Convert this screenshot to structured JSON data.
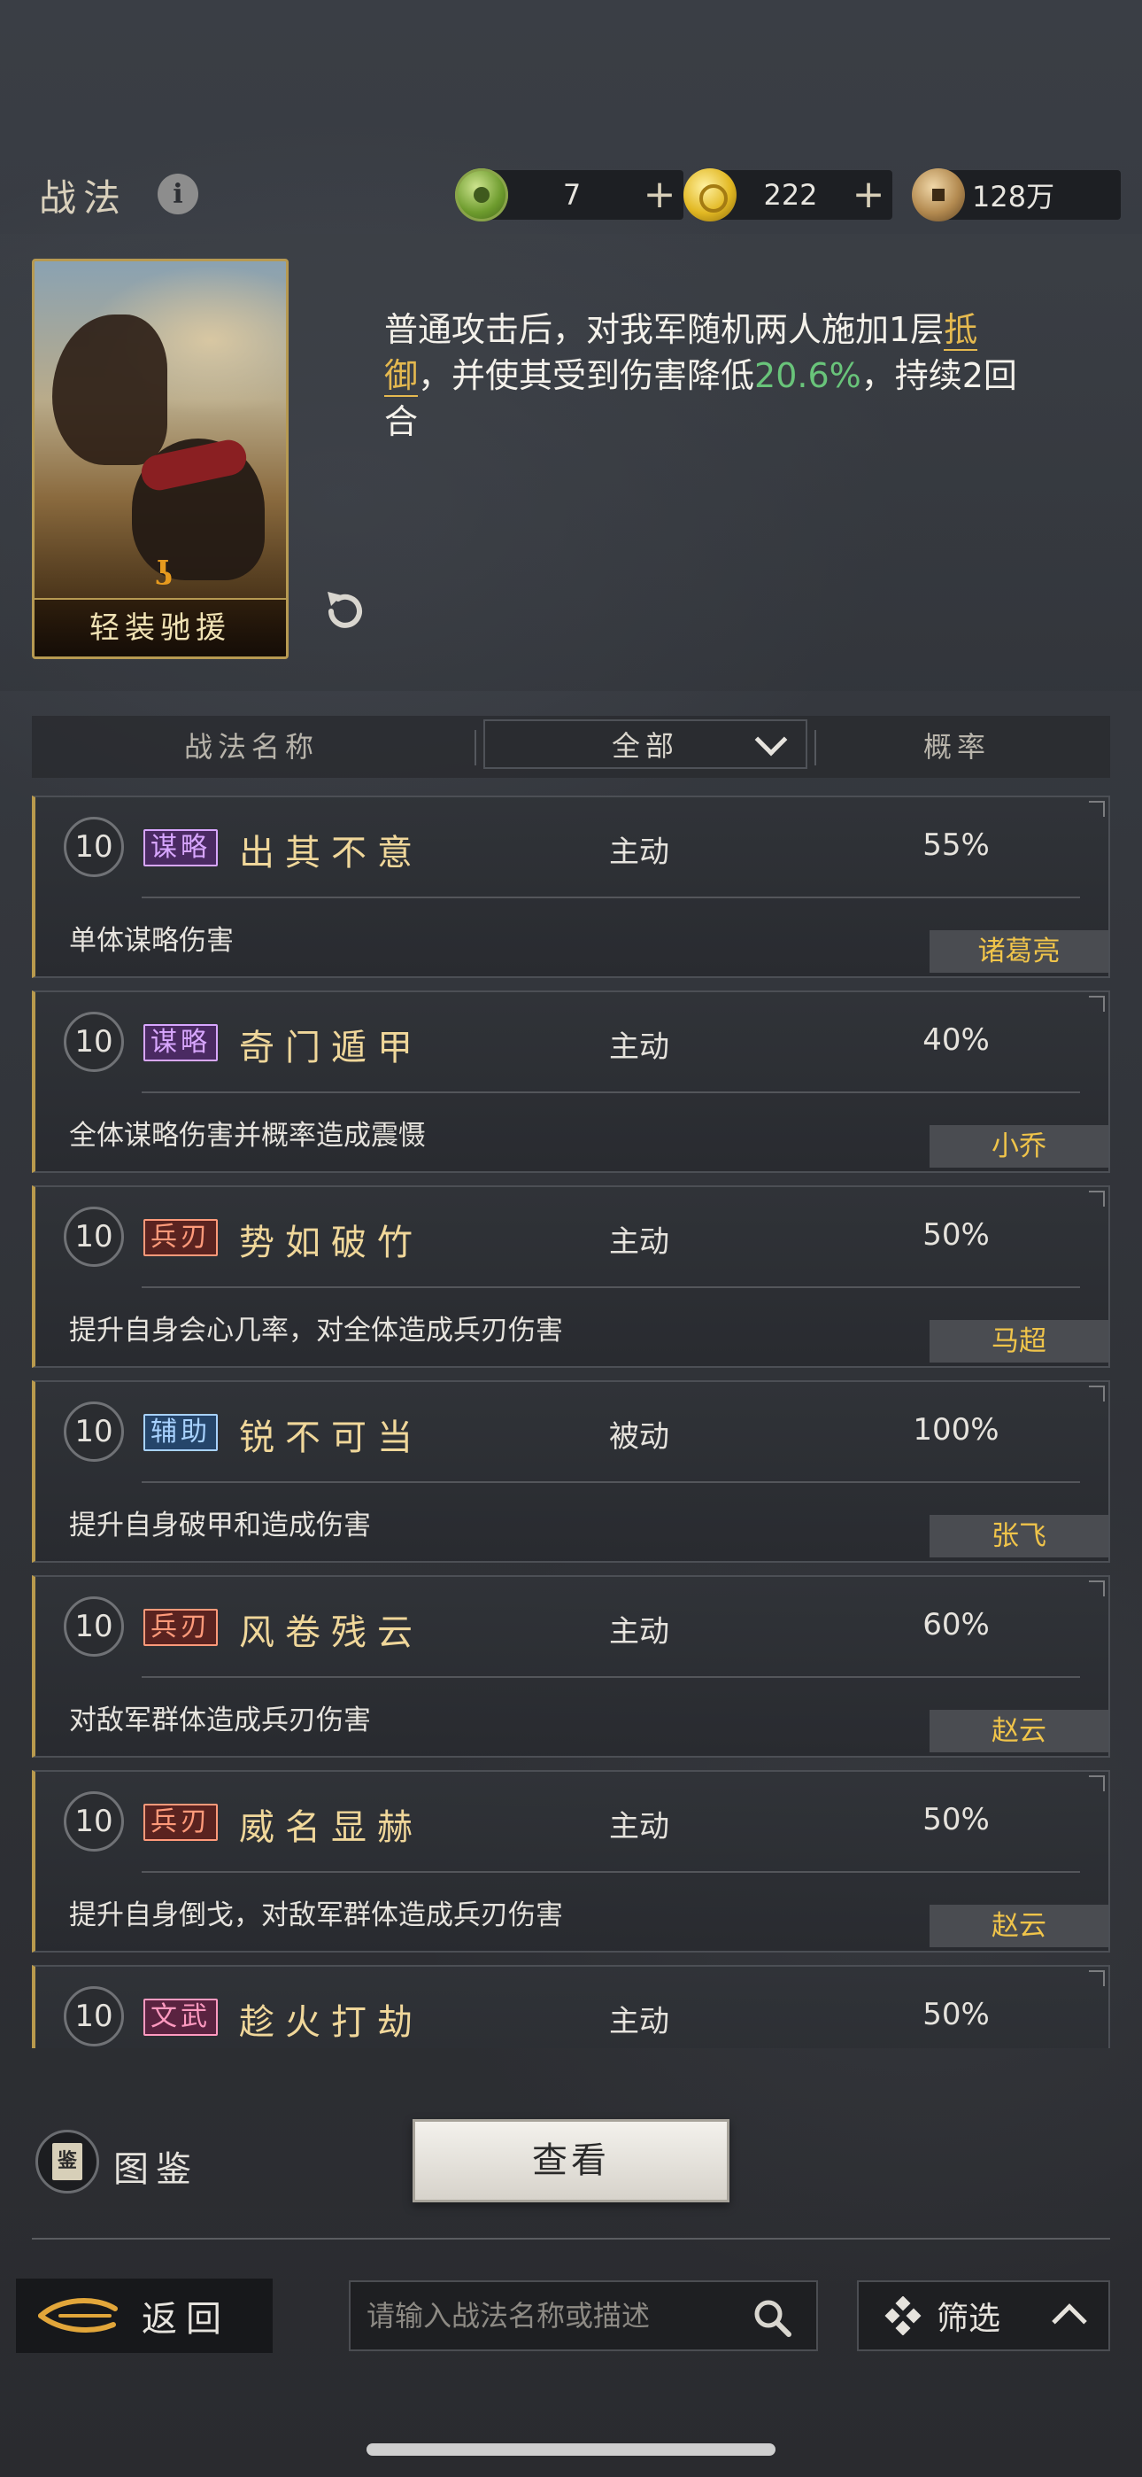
{
  "header": {
    "title": "战法",
    "info_icon": "info-icon",
    "resources": [
      {
        "icon": "jade-coin-icon",
        "value": "7",
        "has_plus": true
      },
      {
        "icon": "gold-coin-icon",
        "value": "222",
        "has_plus": true
      },
      {
        "icon": "copper-coin-icon",
        "value": "128万",
        "has_plus": false
      }
    ],
    "plus_label": "+"
  },
  "selected_tactic": {
    "card_name": "轻装驰援",
    "description_parts": {
      "p1": "普通攻击后，对我军随机两人施加1层",
      "highlight": "抵御",
      "p2": "，并使其受到伤害降低",
      "number": "20.6%",
      "p3": "，持续2回合"
    },
    "colors": {
      "highlight": "#e5b94f",
      "number": "#69c47a"
    }
  },
  "table_header": {
    "name_col": "战法名称",
    "filter_value": "全部",
    "rate_col": "概率"
  },
  "tactics": [
    {
      "level": "10",
      "tag": "谋略",
      "tag_type": "mou",
      "name": "出其不意",
      "type": "主动",
      "rate": "55%",
      "desc": "单体谋略伤害",
      "hero": "诸葛亮"
    },
    {
      "level": "10",
      "tag": "谋略",
      "tag_type": "mou",
      "name": "奇门遁甲",
      "type": "主动",
      "rate": "40%",
      "desc": "全体谋略伤害并概率造成震慑",
      "hero": "小乔"
    },
    {
      "level": "10",
      "tag": "兵刃",
      "tag_type": "bing",
      "name": "势如破竹",
      "type": "主动",
      "rate": "50%",
      "desc": "提升自身会心几率，对全体造成兵刃伤害",
      "hero": "马超"
    },
    {
      "level": "10",
      "tag": "辅助",
      "tag_type": "fu",
      "name": "锐不可当",
      "type": "被动",
      "rate": "100%",
      "desc": "提升自身破甲和造成伤害",
      "hero": "张飞"
    },
    {
      "level": "10",
      "tag": "兵刃",
      "tag_type": "bing",
      "name": "风卷残云",
      "type": "主动",
      "rate": "60%",
      "desc": "对敌军群体造成兵刃伤害",
      "hero": "赵云"
    },
    {
      "level": "10",
      "tag": "兵刃",
      "tag_type": "bing",
      "name": "威名显赫",
      "type": "主动",
      "rate": "50%",
      "desc": "提升自身倒戈，对敌军群体造成兵刃伤害",
      "hero": "赵云"
    },
    {
      "level": "10",
      "tag": "文武",
      "tag_type": "wen",
      "name": "趁火打劫",
      "type": "主动",
      "rate": "50%",
      "desc": "",
      "hero": ""
    }
  ],
  "bottom": {
    "tujian_icon_text": "鉴",
    "tujian_label": "图鉴",
    "view_button": "查看",
    "back_label": "返回",
    "search_placeholder": "请输入战法名称或描述",
    "filter_label": "筛选"
  }
}
